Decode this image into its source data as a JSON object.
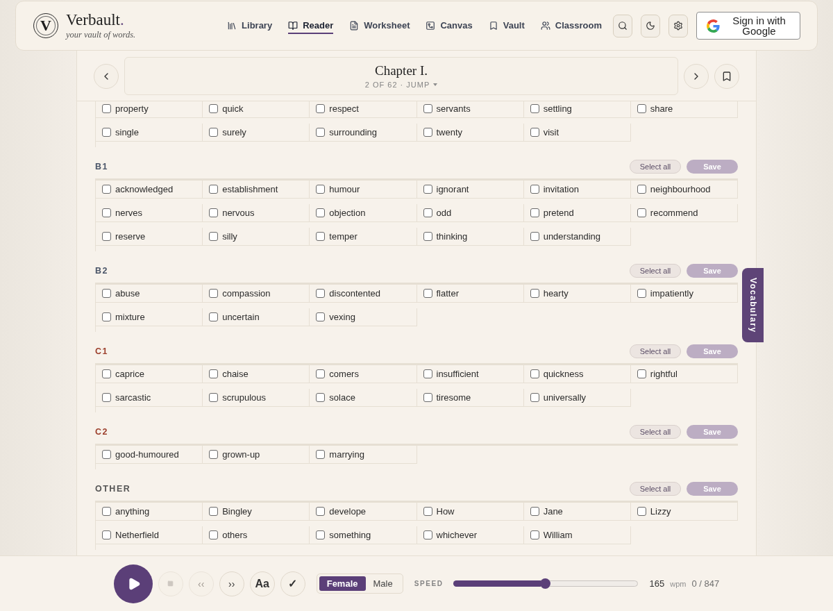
{
  "header": {
    "logo_letter": "V",
    "brand": {
      "name": "Verbault",
      "dot": "."
    },
    "tagline": "your vault of words.",
    "nav": [
      {
        "label": "Library",
        "selected": false
      },
      {
        "label": "Reader",
        "selected": true
      },
      {
        "label": "Worksheet",
        "selected": false
      },
      {
        "label": "Canvas",
        "selected": false
      },
      {
        "label": "Vault",
        "selected": false
      },
      {
        "label": "Classroom",
        "selected": false
      }
    ],
    "sign_in": "Sign in with Google"
  },
  "chapter": {
    "title": "Chapter I.",
    "subtitle": "2 OF 62 · JUMP"
  },
  "word_sections": [
    {
      "words": [
        {
          "label": "property",
          "checked": false
        },
        {
          "label": "quick",
          "checked": false
        },
        {
          "label": "respect",
          "checked": false
        },
        {
          "label": "servants",
          "checked": false
        },
        {
          "label": "settling",
          "checked": false
        },
        {
          "label": "share",
          "checked": false
        },
        {
          "label": "single",
          "checked": false
        },
        {
          "label": "surely",
          "checked": false
        },
        {
          "label": "surrounding",
          "checked": false
        },
        {
          "label": "twenty",
          "checked": false
        },
        {
          "label": "visit",
          "checked": false
        }
      ]
    },
    {
      "level": "B1",
      "color": "#4a5568",
      "select_all": "Select all",
      "save": {
        "label": "Save",
        "disabled": true
      },
      "words": [
        {
          "label": "acknowledged",
          "checked": false
        },
        {
          "label": "establishment",
          "checked": false
        },
        {
          "label": "humour",
          "checked": false
        },
        {
          "label": "ignorant",
          "checked": false
        },
        {
          "label": "invitation",
          "checked": false
        },
        {
          "label": "neighbourhood",
          "checked": false
        },
        {
          "label": "nerves",
          "checked": false
        },
        {
          "label": "nervous",
          "checked": false
        },
        {
          "label": "objection",
          "checked": false
        },
        {
          "label": "odd",
          "checked": false
        },
        {
          "label": "pretend",
          "checked": false
        },
        {
          "label": "recommend",
          "checked": false
        },
        {
          "label": "reserve",
          "checked": false
        },
        {
          "label": "silly",
          "checked": false
        },
        {
          "label": "temper",
          "checked": false
        },
        {
          "label": "thinking",
          "checked": false
        },
        {
          "label": "understanding",
          "checked": false
        }
      ]
    },
    {
      "level": "B2",
      "color": "#4a5568",
      "select_all": "Select all",
      "save": {
        "label": "Save",
        "disabled": true
      },
      "words": [
        {
          "label": "abuse",
          "checked": false
        },
        {
          "label": "compassion",
          "checked": false
        },
        {
          "label": "discontented",
          "checked": false
        },
        {
          "label": "flatter",
          "checked": false
        },
        {
          "label": "hearty",
          "checked": false
        },
        {
          "label": "impatiently",
          "checked": false
        },
        {
          "label": "mixture",
          "checked": false
        },
        {
          "label": "uncertain",
          "checked": false
        },
        {
          "label": "vexing",
          "checked": false
        }
      ]
    },
    {
      "level": "C1",
      "color": "#9c3f2c",
      "select_all": "Select all",
      "save": {
        "label": "Save",
        "disabled": true
      },
      "words": [
        {
          "label": "caprice",
          "checked": false
        },
        {
          "label": "chaise",
          "checked": false
        },
        {
          "label": "comers",
          "checked": false
        },
        {
          "label": "insufficient",
          "checked": false
        },
        {
          "label": "quickness",
          "checked": false
        },
        {
          "label": "rightful",
          "checked": false
        },
        {
          "label": "sarcastic",
          "checked": false
        },
        {
          "label": "scrupulous",
          "checked": false
        },
        {
          "label": "solace",
          "checked": false
        },
        {
          "label": "tiresome",
          "checked": false
        },
        {
          "label": "universally",
          "checked": false
        }
      ]
    },
    {
      "level": "C2",
      "color": "#9c3f2c",
      "select_all": "Select all",
      "save": {
        "label": "Save",
        "disabled": true
      },
      "words": [
        {
          "label": "good-humoured",
          "checked": false
        },
        {
          "label": "grown-up",
          "checked": false
        },
        {
          "label": "marrying",
          "checked": false
        }
      ]
    },
    {
      "level": "OTHER",
      "color": "#555555",
      "select_all": "Select all",
      "save": {
        "label": "Save",
        "disabled": true
      },
      "words": [
        {
          "label": "anything",
          "checked": false
        },
        {
          "label": "Bingley",
          "checked": false
        },
        {
          "label": "develope",
          "checked": false
        },
        {
          "label": "How",
          "checked": false
        },
        {
          "label": "Jane",
          "checked": false
        },
        {
          "label": "Lizzy",
          "checked": false
        },
        {
          "label": "Netherfield",
          "checked": false
        },
        {
          "label": "others",
          "checked": false
        },
        {
          "label": "something",
          "checked": false
        },
        {
          "label": "whichever",
          "checked": false
        },
        {
          "label": "William",
          "checked": false
        }
      ]
    }
  ],
  "vocabulary_tab": "Vocabulary",
  "player": {
    "buttons": [
      {
        "kind": "play",
        "disabled": false
      },
      {
        "kind": "stop",
        "disabled": true
      },
      {
        "kind": "rewind",
        "label": "‹‹",
        "disabled": true
      },
      {
        "kind": "forward",
        "label": "››",
        "disabled": false
      },
      {
        "kind": "font",
        "label": "Aa",
        "disabled": false
      },
      {
        "kind": "check",
        "label": "✓",
        "disabled": false
      }
    ],
    "voices": [
      {
        "label": "Female",
        "selected": true
      },
      {
        "label": "Male",
        "selected": false
      }
    ],
    "speed_label": "SPEED",
    "speed": {
      "level": 0.5
    },
    "wpm": "165",
    "wpm_unit": "wpm",
    "word_count": "0 / 847"
  }
}
